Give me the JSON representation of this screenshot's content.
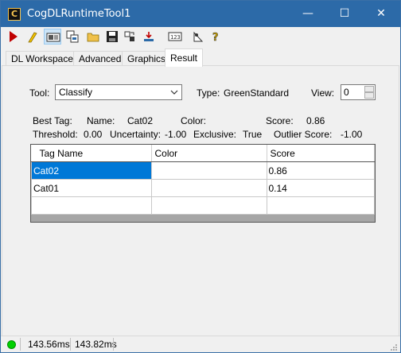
{
  "window": {
    "title": "CogDLRuntimeTool1",
    "icon_letter": "C"
  },
  "window_controls": {
    "minimize": "—",
    "maximize": "☐",
    "close": "✕"
  },
  "toolbar": {
    "buttons": [
      "run-icon",
      "wand-icon",
      "display-icon",
      "copy-window-icon",
      "open-folder-icon",
      "save-icon",
      "export-icon",
      "import-icon",
      "counter-icon",
      "settings-icon",
      "help-icon"
    ]
  },
  "tabs": [
    "DL Workspace",
    "Advanced",
    "Graphics",
    "Result"
  ],
  "selected_tab": "Result",
  "result": {
    "tool_label": "Tool:",
    "tool_value": "Classify",
    "type_label": "Type:",
    "type_value": "GreenStandard",
    "view_label": "View:",
    "view_value": "0",
    "best_tag_label": "Best Tag:",
    "name_label": "Name:",
    "name_value": "Cat02",
    "color_label": "Color:",
    "score_label": "Score:",
    "score_value": "0.86",
    "threshold_label": "Threshold:",
    "threshold_value": "0.00",
    "uncertainty_label": "Uncertainty:",
    "uncertainty_value": "-1.00",
    "exclusive_label": "Exclusive:",
    "exclusive_value": "True",
    "outlier_label": "Outlier Score:",
    "outlier_value": "-1.00"
  },
  "table": {
    "columns": [
      "Tag Name",
      "Color",
      "Score"
    ],
    "rows": [
      {
        "tag": "Cat02",
        "color": "",
        "score": "0.86",
        "selected": true
      },
      {
        "tag": "Cat01",
        "color": "",
        "score": "0.14",
        "selected": false
      }
    ]
  },
  "status": {
    "time1": "143.56ms",
    "time2": "143.82ms"
  },
  "colors": {
    "titlebar": "#2c6aa8",
    "selection": "#0078d7",
    "status_led": "#00d000"
  }
}
